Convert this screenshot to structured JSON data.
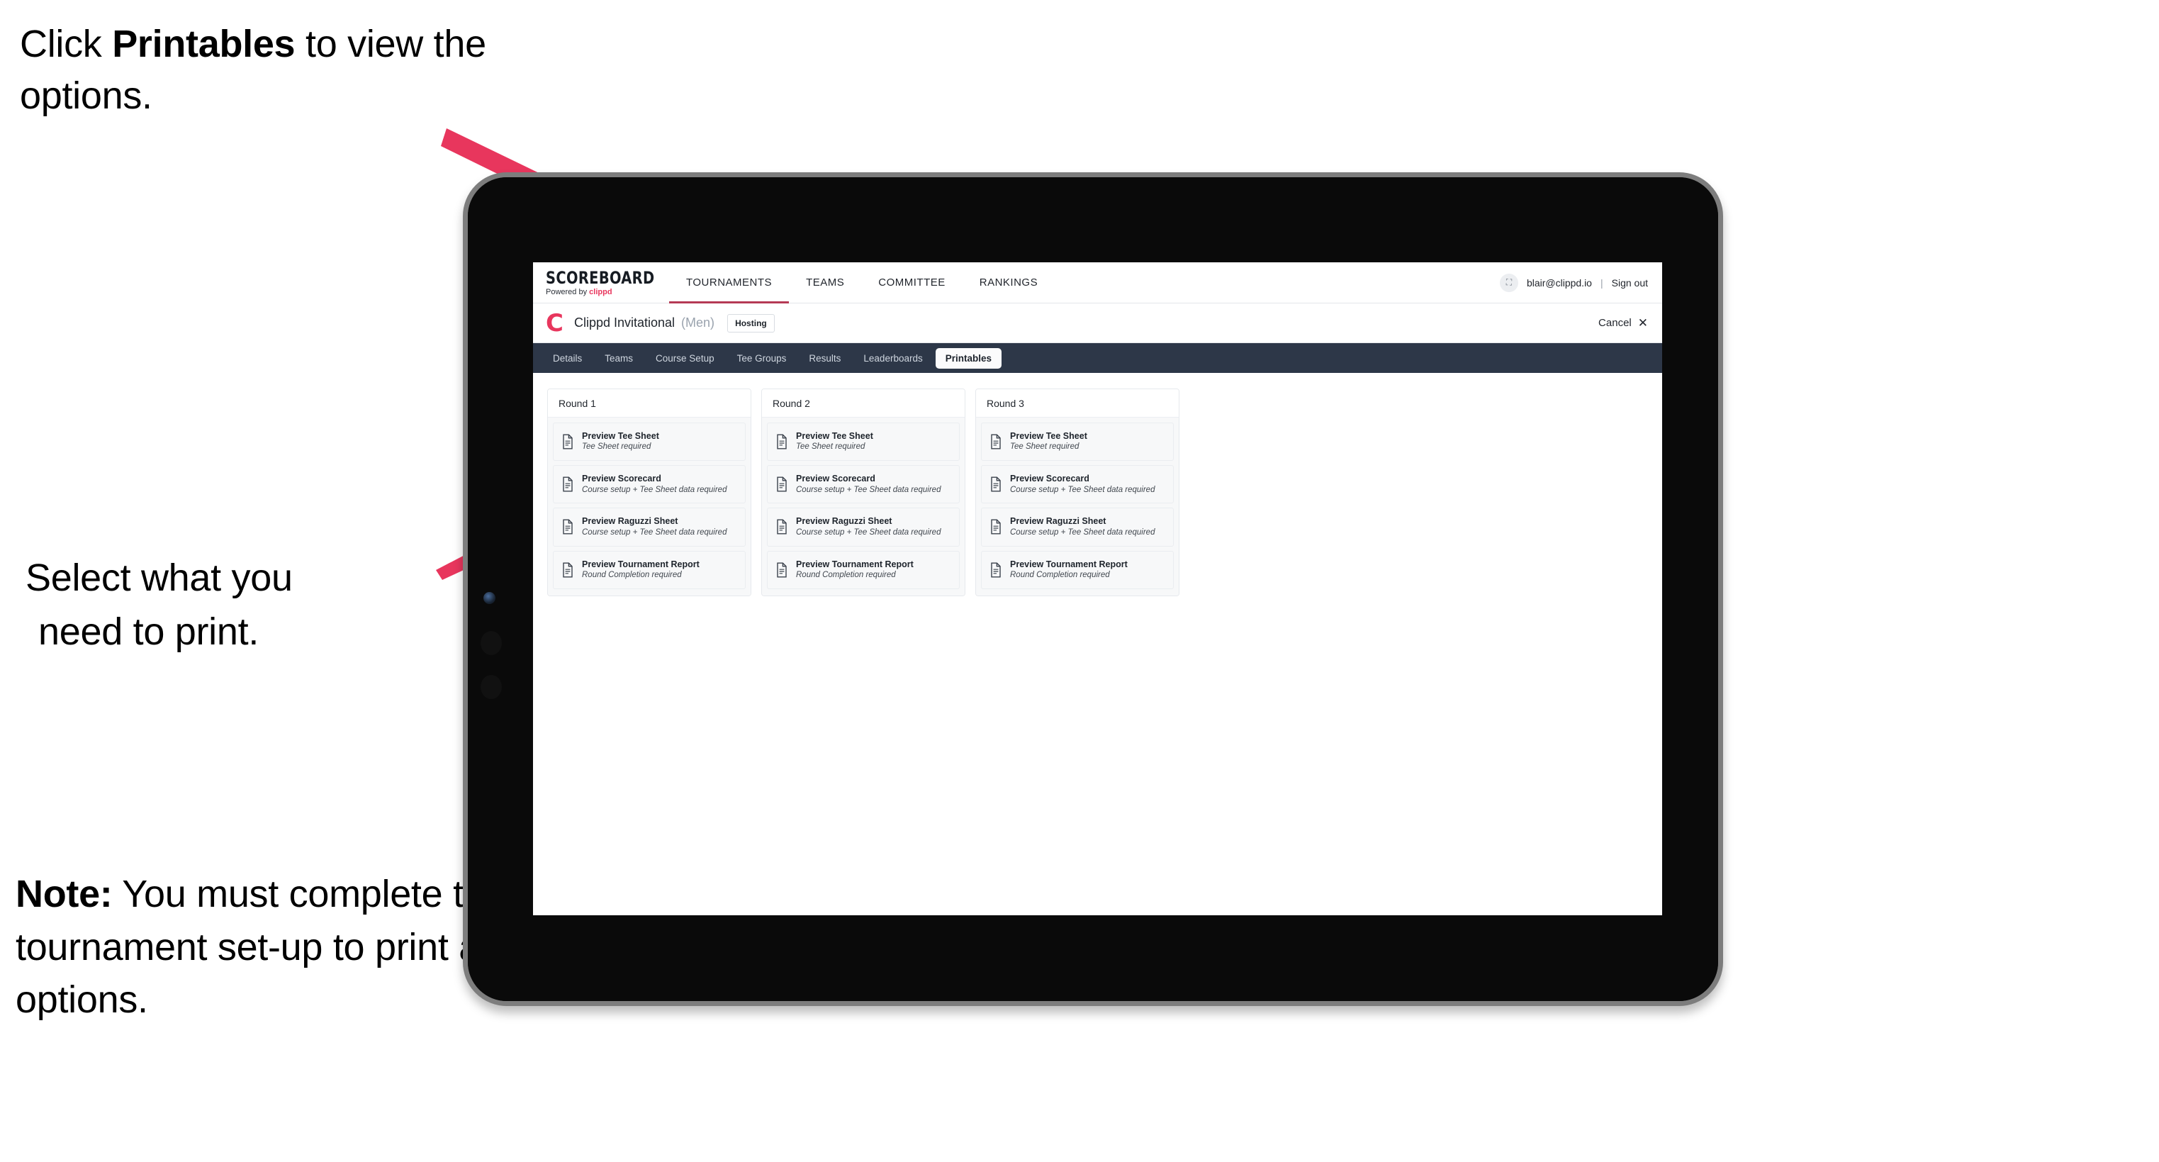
{
  "annotations": {
    "step1_prefix": "Click ",
    "step1_bold": "Printables",
    "step1_suffix": " to view the options.",
    "step2_line1": "Select what you",
    "step2_line2": "need to print.",
    "note_label": "Note:",
    "note_text": " You must complete the tournament set-up to print all the options.",
    "arrow_color": "#e8365d"
  },
  "app": {
    "logo_word": "SCOREBOARD",
    "logo_sub_prefix": "Powered by ",
    "logo_sub_brand": "clippd",
    "top_nav": [
      {
        "label": "TOURNAMENTS",
        "active": true
      },
      {
        "label": "TEAMS",
        "active": false
      },
      {
        "label": "COMMITTEE",
        "active": false
      },
      {
        "label": "RANKINGS",
        "active": false
      }
    ],
    "account": {
      "avatar_glyph": "⛶",
      "email": "blair@clippd.io",
      "separator": "|",
      "sign_out": "Sign out"
    },
    "title_bar": {
      "brand_mark": "C",
      "tournament_name": "Clippd Invitational",
      "gender": "(Men)",
      "status_badge": "Hosting",
      "cancel_label": "Cancel",
      "cancel_icon": "✕"
    },
    "section_tabs": [
      {
        "label": "Details",
        "active": false
      },
      {
        "label": "Teams",
        "active": false
      },
      {
        "label": "Course Setup",
        "active": false
      },
      {
        "label": "Tee Groups",
        "active": false
      },
      {
        "label": "Results",
        "active": false
      },
      {
        "label": "Leaderboards",
        "active": false
      },
      {
        "label": "Printables",
        "active": true
      }
    ],
    "accent_pink": "#e8365d",
    "section_bar_bg": "#2d3748"
  },
  "printables": {
    "rounds": [
      {
        "title": "Round 1",
        "items": [
          {
            "title": "Preview Tee Sheet",
            "subtitle": "Tee Sheet required"
          },
          {
            "title": "Preview Scorecard",
            "subtitle": "Course setup + Tee Sheet data required"
          },
          {
            "title": "Preview Raguzzi Sheet",
            "subtitle": "Course setup + Tee Sheet data required"
          },
          {
            "title": "Preview Tournament Report",
            "subtitle": "Round Completion required"
          }
        ]
      },
      {
        "title": "Round 2",
        "items": [
          {
            "title": "Preview Tee Sheet",
            "subtitle": "Tee Sheet required"
          },
          {
            "title": "Preview Scorecard",
            "subtitle": "Course setup + Tee Sheet data required"
          },
          {
            "title": "Preview Raguzzi Sheet",
            "subtitle": "Course setup + Tee Sheet data required"
          },
          {
            "title": "Preview Tournament Report",
            "subtitle": "Round Completion required"
          }
        ]
      },
      {
        "title": "Round 3",
        "items": [
          {
            "title": "Preview Tee Sheet",
            "subtitle": "Tee Sheet required"
          },
          {
            "title": "Preview Scorecard",
            "subtitle": "Course setup + Tee Sheet data required"
          },
          {
            "title": "Preview Raguzzi Sheet",
            "subtitle": "Course setup + Tee Sheet data required"
          },
          {
            "title": "Preview Tournament Report",
            "subtitle": "Round Completion required"
          }
        ]
      }
    ]
  }
}
